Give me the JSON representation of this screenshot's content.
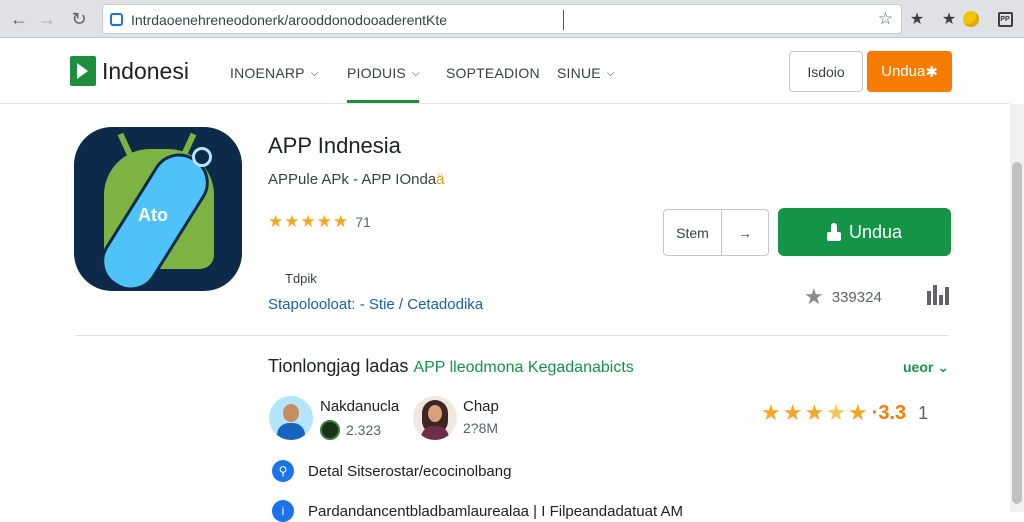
{
  "browser": {
    "url": "Intrdaoenehreneodonerk/arooddonodooaderentKte",
    "icons": {
      "back": "back-arrow-icon",
      "forward": "forward-arrow-icon",
      "reload": "reload-icon",
      "bookmark": "bookmark-star-icon",
      "extension": "extension-icon",
      "profile": "profile-icon"
    }
  },
  "header": {
    "logo_text": "Indonesi",
    "nav": [
      {
        "label": "INOENARP"
      },
      {
        "label": "PIODUIS"
      },
      {
        "label": "SOPTEADION"
      },
      {
        "label": "SINUE"
      }
    ],
    "btn_outline": "Isdoio",
    "btn_orange": "Undua"
  },
  "app": {
    "title": "APP Indnesia",
    "subtitle": "APPule APk - APP IOnda",
    "subtitle_accent": "ä",
    "icon_label": "Ato",
    "rating_text": "71",
    "topik": "Tdpik",
    "categories": "Stapolooloat:  - Stie / Cetadodika",
    "btn_small_1": "Stem",
    "btn_small_2": "→",
    "btn_download": "Undua",
    "download_count": "339324",
    "colors": {
      "primary_green": "#139447",
      "orange": "#f57c00",
      "star": "#f5a623",
      "link_blue": "#1a5fb4"
    }
  },
  "reviews": {
    "title": "Tionlongjag ladas",
    "title_green": "APP lleodmona Kegadanabicts",
    "see_all": "ueor",
    "items": [
      {
        "name": "Nakdanucla",
        "meta": "2.323"
      },
      {
        "name": "Chap",
        "meta": "2?8M"
      }
    ],
    "score": "·3.3",
    "count": "1",
    "details": [
      {
        "icon": "search-icon",
        "text": "Detal Sitserostar/ecocinolbang"
      },
      {
        "icon": "info-icon",
        "text": "Pardandancentbladbamlaurealaa  |  I Filpeandadatuat AM"
      }
    ]
  }
}
